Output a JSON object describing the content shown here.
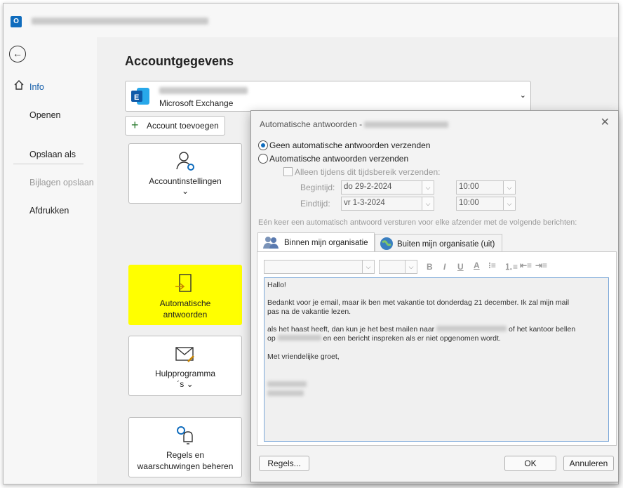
{
  "window": {
    "title": "Postvak IN - name@domain - Outlook",
    "app_icon": "outlook-icon"
  },
  "nav": {
    "back": "back-arrow-icon",
    "items": [
      {
        "label": "Info"
      },
      {
        "label": "Openen"
      },
      {
        "label": "Opslaan als"
      },
      {
        "label": "Bijlagen opslaan"
      },
      {
        "label": "Afdrukken"
      }
    ]
  },
  "main": {
    "title": "Accountgegevens",
    "account": {
      "name": "name@domain.nl",
      "type": "Microsoft Exchange"
    },
    "add_account": "Account toevoegen",
    "tiles": {
      "settings": {
        "label": "Accountinstellingen",
        "chevron": "⌄"
      },
      "auto_reply": {
        "line1": "Automatische",
        "line2": "antwoorden"
      },
      "tools": {
        "line1": "Hulpprogramma",
        "line2": "´s ⌄"
      },
      "rules": {
        "line1": "Regels en",
        "line2": "waarschuwingen beheren"
      }
    }
  },
  "dialog": {
    "title": "Automatische antwoorden - ",
    "title_account": "name@domain.nl",
    "radio_off": "Geen automatische antwoorden verzenden",
    "radio_on": "Automatische antwoorden verzenden",
    "timerange": "Alleen tijdens dit tijdsbereik verzenden:",
    "start_label": "Begintijd:",
    "end_label": "Eindtijd:",
    "start_date": "do 29-2-2024",
    "start_time": "10:00",
    "end_date": "vr 1-3-2024",
    "end_time": "10:00",
    "once_text": "Eén keer een automatisch antwoord versturen voor elke afzender met de volgende berichten:",
    "tab_inside": "Binnen mijn organisatie",
    "tab_outside": "Buiten mijn organisatie (uit)",
    "toolbar": {
      "bold": "B",
      "italic": "I",
      "underline": "U",
      "color": "A"
    },
    "message": {
      "greeting": "Hallo!",
      "p1a": "Bedankt voor je email, maar ik ben met vakantie tot donderdag 21 december. Ik zal mijn mail",
      "p1b": "pas na de vakantie lezen.",
      "p2a_start": "als het haast heeft, dan kun je het best mailen naar",
      "p2a_end": "of het kantoor bellen",
      "p2b_start": "op",
      "p2b_end": "en een bericht inspreken als er niet opgenomen wordt.",
      "closing": "Met vriendelijke groet,"
    },
    "rules_btn": "Regels...",
    "ok_btn": "OK",
    "cancel_btn": "Annuleren"
  },
  "colors": {
    "accent": "#0f6cbd",
    "highlight": "#ffff00"
  }
}
